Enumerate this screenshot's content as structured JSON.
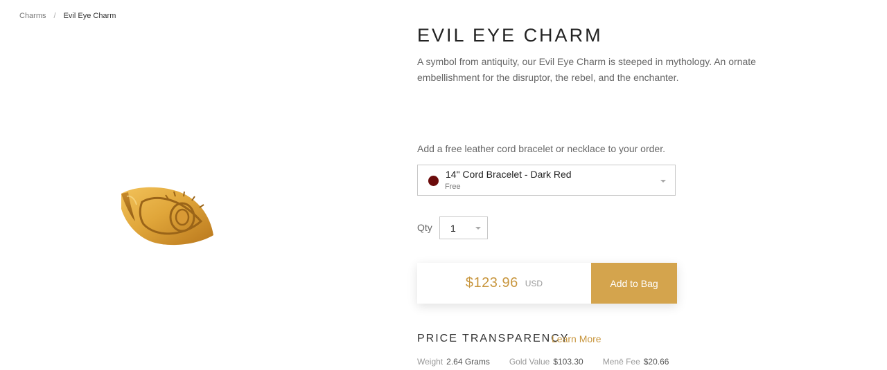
{
  "colors": {
    "accent_gold": "#d4a44d",
    "price_gold": "#c8963e",
    "cord_dark_red": "#6b0b0b"
  },
  "breadcrumb": {
    "items": [
      "Charms"
    ],
    "current": "Evil Eye Charm"
  },
  "product": {
    "title": "EVIL EYE CHARM",
    "description": "A symbol from antiquity, our Evil Eye Charm is steeped in mythology. An ornate embellishment for the disruptor, the rebel, and the enchanter.",
    "image_icon": "gold-evil-eye-charm"
  },
  "addon": {
    "label": "Add a free leather cord bracelet or necklace to your order.",
    "selected_option": "14\" Cord Bracelet - Dark Red",
    "selected_price": "Free",
    "swatch_icon": "color-swatch"
  },
  "quantity": {
    "label": "Qty",
    "value": "1"
  },
  "purchase": {
    "price": "$123.96",
    "currency": "USD",
    "button_label": "Add to Bag"
  },
  "transparency": {
    "title": "PRICE TRANSPARENCY",
    "link_label": "Learn More",
    "stats": [
      {
        "label": "Weight",
        "value": "2.64 Grams"
      },
      {
        "label": "Gold Value",
        "value": "$103.30"
      },
      {
        "label": "Menē Fee",
        "value": "$20.66"
      }
    ]
  }
}
